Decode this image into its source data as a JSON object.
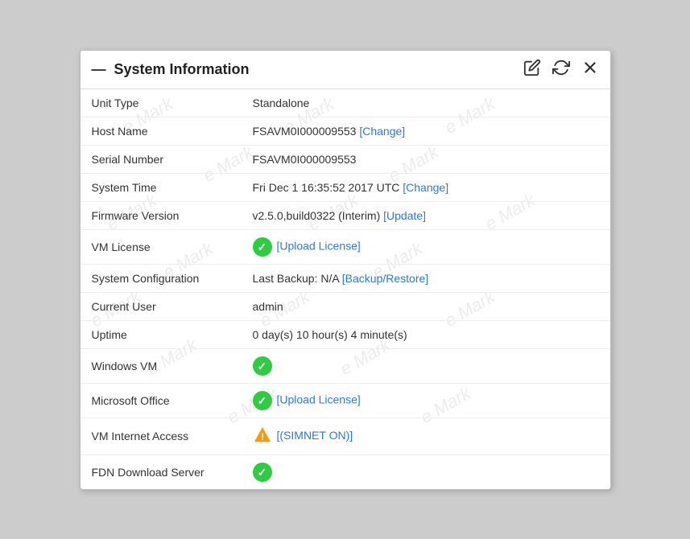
{
  "panel": {
    "title": "System Information",
    "header_icon": "—",
    "actions": {
      "edit_label": "edit",
      "refresh_label": "refresh",
      "close_label": "close"
    }
  },
  "rows": [
    {
      "label": "Unit Type",
      "value": "Standalone",
      "type": "text"
    },
    {
      "label": "Host Name",
      "value": "FSAVM0I000009553",
      "link": "[Change]",
      "type": "text-link"
    },
    {
      "label": "Serial Number",
      "value": "FSAVM0I000009553",
      "type": "text"
    },
    {
      "label": "System Time",
      "value": "Fri Dec 1 16:35:52 2017 UTC",
      "link": "[Change]",
      "type": "text-link"
    },
    {
      "label": "Firmware Version",
      "value": "v2.5.0,build0322 (Interim)",
      "link": "[Update]",
      "type": "text-link"
    },
    {
      "label": "VM License",
      "value": "",
      "link": "[Upload License]",
      "type": "check-link"
    },
    {
      "label": "System Configuration",
      "value": "Last Backup: N/A",
      "link": "[Backup/Restore]",
      "type": "text-link"
    },
    {
      "label": "Current User",
      "value": "admin",
      "type": "text"
    },
    {
      "label": "Uptime",
      "value": "0 day(s) 10 hour(s) 4 minute(s)",
      "type": "text"
    },
    {
      "label": "Windows VM",
      "value": "",
      "type": "check"
    },
    {
      "label": "Microsoft Office",
      "value": "",
      "link": "[Upload License]",
      "type": "check-link"
    },
    {
      "label": "VM Internet Access",
      "value": "",
      "link": "[(SIMNET ON)]",
      "type": "warn-link"
    },
    {
      "label": "FDN Download Server",
      "value": "",
      "type": "check"
    }
  ],
  "watermark": "Mark"
}
